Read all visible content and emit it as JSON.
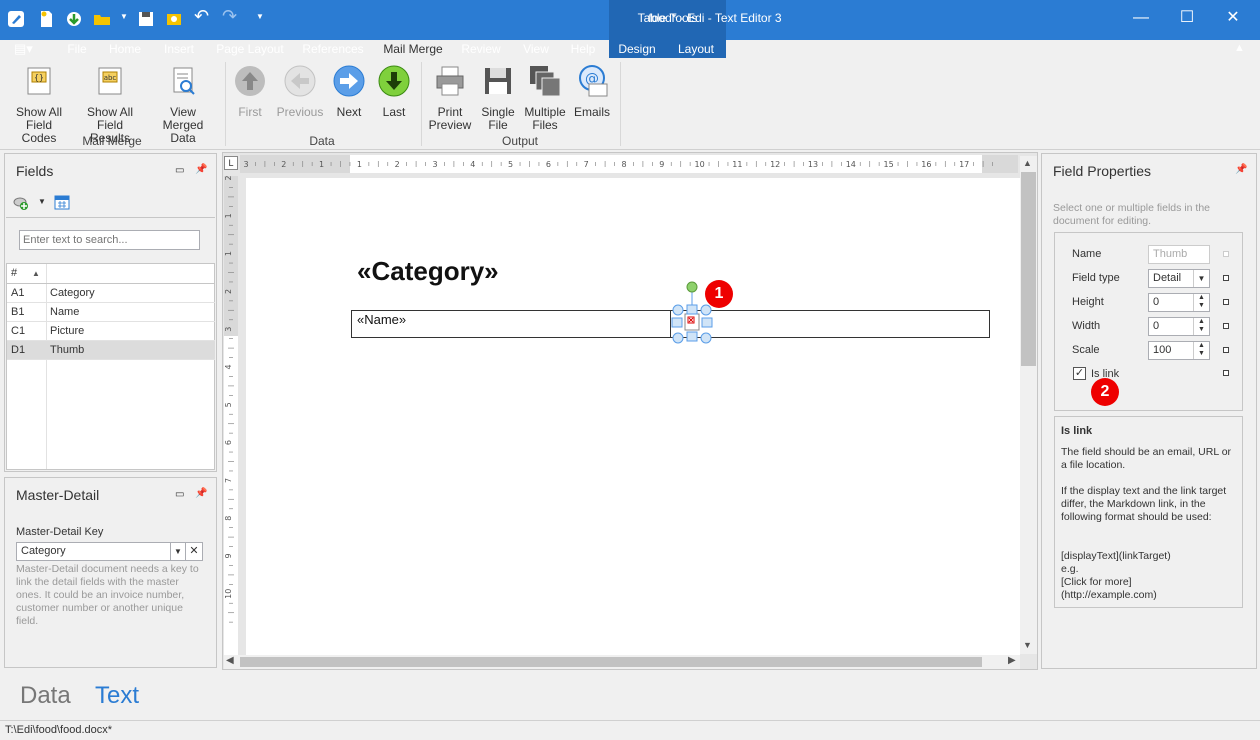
{
  "window": {
    "title": "food* - Edi - Text Editor 3"
  },
  "ribbon_tabs": [
    "File",
    "Home",
    "Insert",
    "Page Layout",
    "References",
    "Mail Merge",
    "Review",
    "View",
    "Help",
    "Design",
    "Layout"
  ],
  "context_tab_group": "Table Tools",
  "mail_merge_group": {
    "label": "Mail Merge",
    "buttons": [
      {
        "line1": "Show All",
        "line2": "Field Codes",
        "icon": "field-codes-icon"
      },
      {
        "line1": "Show All",
        "line2": "Field Results",
        "icon": "field-results-icon"
      },
      {
        "line1": "View Merged",
        "line2": "Data",
        "icon": "view-merged-icon"
      }
    ]
  },
  "data_group": {
    "label": "Data",
    "buttons": [
      {
        "label": "First",
        "enabled": false,
        "icon": "arrow-up-icon"
      },
      {
        "label": "Previous",
        "enabled": false,
        "icon": "arrow-left-icon"
      },
      {
        "label": "Next",
        "enabled": true,
        "icon": "arrow-right-icon"
      },
      {
        "label": "Last",
        "enabled": true,
        "icon": "arrow-down-icon"
      }
    ]
  },
  "output_group": {
    "label": "Output",
    "buttons": [
      {
        "line1": "Print",
        "line2": "Preview",
        "icon": "print-preview-icon"
      },
      {
        "line1": "Single",
        "line2": "File",
        "icon": "floppy-icon"
      },
      {
        "line1": "Multiple",
        "line2": "Files",
        "icon": "multiple-files-icon"
      },
      {
        "line1": "Emails",
        "line2": "",
        "icon": "email-icon"
      }
    ]
  },
  "fields_panel": {
    "title": "Fields",
    "search_placeholder": "Enter text to search...",
    "columns": [
      "#",
      ""
    ],
    "rows": [
      {
        "id": "A1",
        "name": "Category"
      },
      {
        "id": "B1",
        "name": "Name"
      },
      {
        "id": "C1",
        "name": "Picture"
      },
      {
        "id": "D1",
        "name": "Thumb"
      }
    ]
  },
  "master_detail_panel": {
    "title": "Master-Detail",
    "key_label": "Master-Detail Key",
    "key_value": "Category",
    "help": "Master-Detail document needs a key to link the detail fields with the master ones. It could be an invoice number, customer number or another unique field."
  },
  "document": {
    "heading": "«Category»",
    "cell1": "«Name»",
    "ruler_numbers": [
      "3",
      "2",
      "1",
      "1",
      "2",
      "3",
      "4",
      "5",
      "6",
      "7",
      "8",
      "9",
      "10",
      "11",
      "12",
      "13",
      "14",
      "15",
      "16",
      "17"
    ],
    "vruler_numbers": [
      "2",
      "1",
      "1",
      "2",
      "3",
      "4",
      "5",
      "6",
      "7",
      "8",
      "9",
      "10"
    ]
  },
  "field_properties": {
    "title": "Field Properties",
    "hint": "Select one or multiple fields in the document for editing.",
    "name_label": "Name",
    "name_value": "Thumb",
    "type_label": "Field type",
    "type_value": "Detail",
    "height_label": "Height",
    "height_value": "0",
    "width_label": "Width",
    "width_value": "0",
    "scale_label": "Scale",
    "scale_value": "100",
    "islink_label": "Is link",
    "islink_checked": true,
    "help_title": "Is link",
    "help_p1": "The field should be an email, URL or a file location.",
    "help_p2": "If the display text and the link target differ, the Markdown link, in the following format should be used:",
    "help_p3a": "[displayText](linkTarget)",
    "help_p3b": "e.g.",
    "help_p3c": "[Click for more](http://example.com)"
  },
  "badges": [
    "1",
    "2"
  ],
  "bottom_tabs": {
    "data": "Data",
    "text": "Text"
  },
  "status": {
    "path": "T:\\Edi\\food\\food.docx*"
  },
  "colors": {
    "accent": "#2b7cd3",
    "badge": "#e00000",
    "text_tab": "#2b7cd3"
  }
}
